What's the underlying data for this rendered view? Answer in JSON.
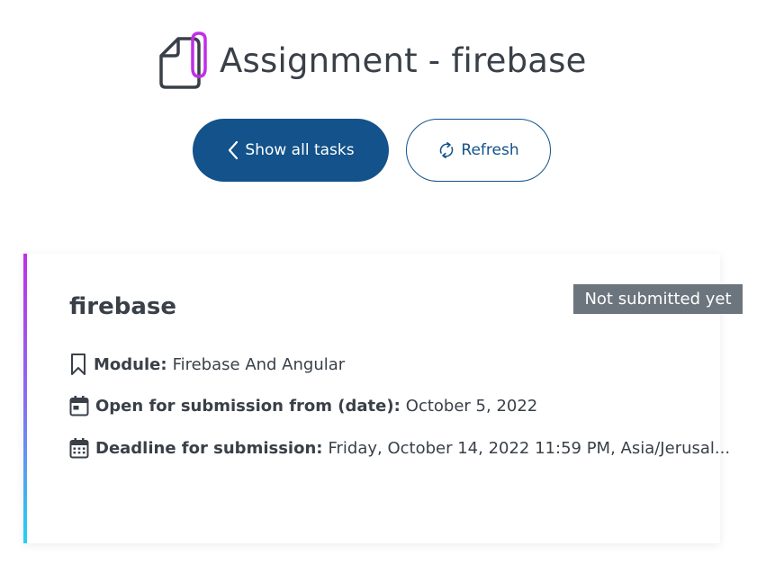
{
  "header": {
    "title": "Assignment - firebase",
    "icon": "assignment-paperclip-icon",
    "accent_color": "#c02fe8"
  },
  "toolbar": {
    "show_all_label": "Show all tasks",
    "show_all_icon": "chevron-left-icon",
    "refresh_label": "Refresh",
    "refresh_icon": "refresh-icon",
    "primary_color": "#13528a"
  },
  "task": {
    "title": "firebase",
    "status": "Not submitted yet",
    "status_color": "#6c757d",
    "module_label": "Module:",
    "module_value": "Firebase And Angular",
    "module_icon": "bookmark-icon",
    "open_label": "Open for submission from (date):",
    "open_value": "October 5, 2022",
    "open_icon": "calendar-icon",
    "deadline_label": "Deadline for submission:",
    "deadline_value": "Friday, October 14, 2022 11:59 PM, Asia/Jerusal...",
    "deadline_icon": "calendar-grid-icon"
  }
}
